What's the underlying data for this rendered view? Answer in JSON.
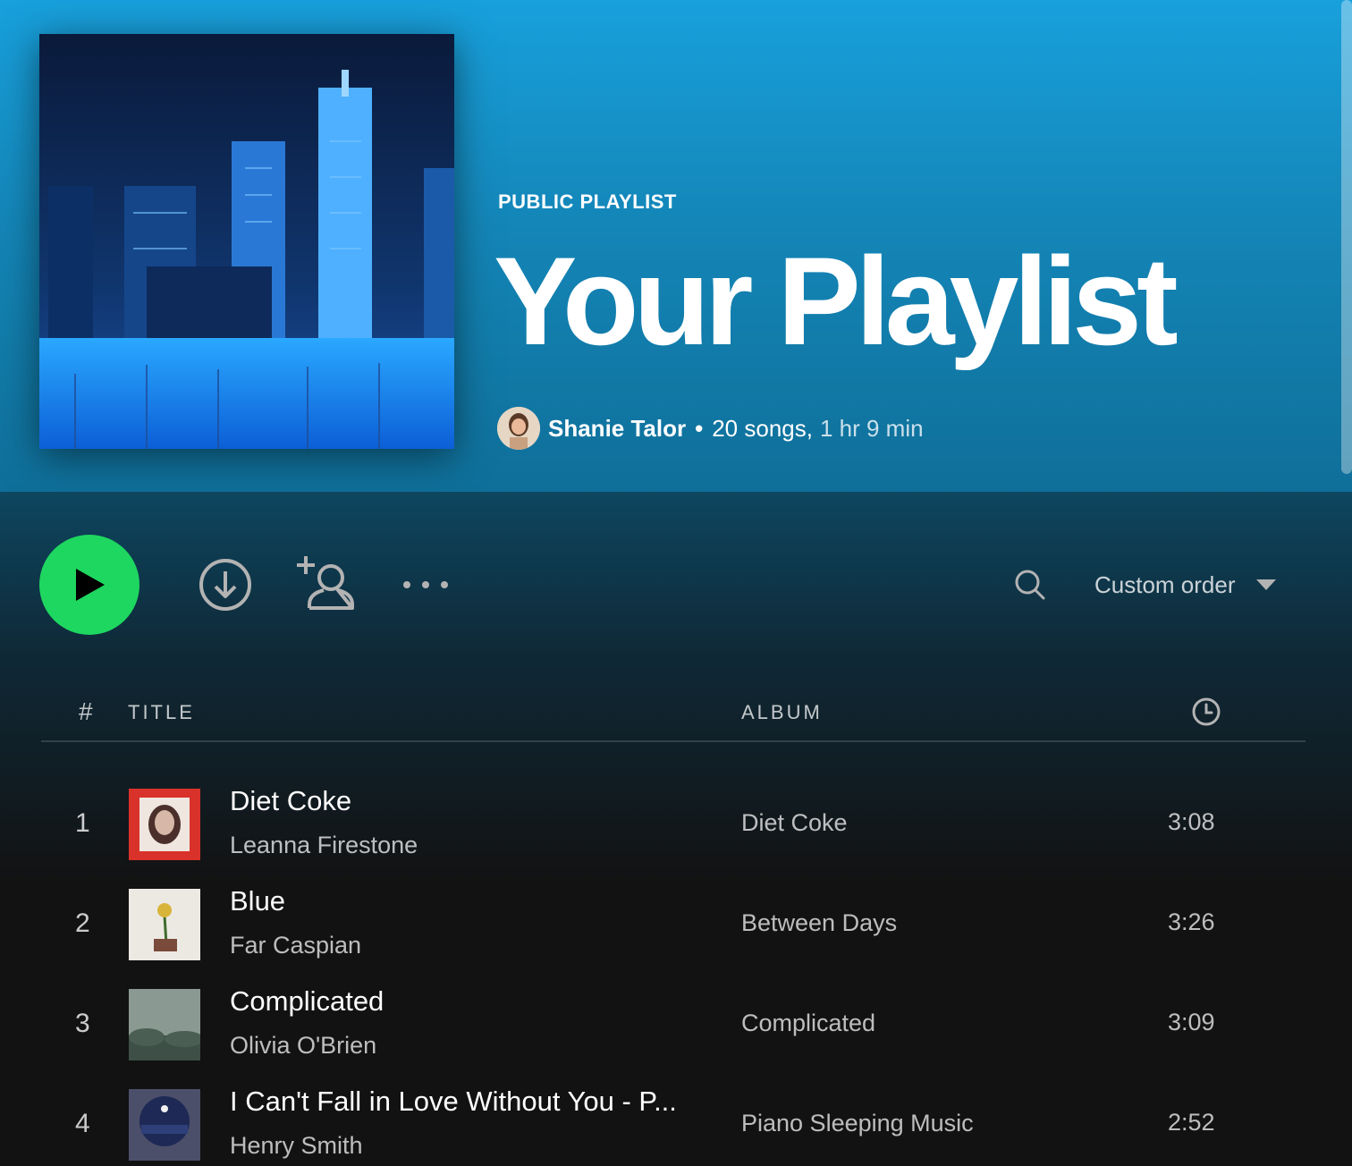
{
  "header": {
    "kind": "PUBLIC PLAYLIST",
    "title": "Your Playlist",
    "owner": "Shanie Talor",
    "separator": "•",
    "song_count": "20 songs,",
    "duration": "1 hr 9 min",
    "bg_color": "#1486b8"
  },
  "actions": {
    "play_icon": "play-icon",
    "download_icon": "download-icon",
    "follow_icon": "add-user-icon",
    "more_icon": "more-icon",
    "more_label": "• • •",
    "search_icon": "search-icon",
    "sort_label": "Custom order",
    "accent": "#1ed760"
  },
  "table": {
    "columns": {
      "number": "#",
      "title": "TITLE",
      "album": "ALBUM",
      "duration_icon": "clock-icon"
    },
    "rows": [
      {
        "number": "1",
        "title": "Diet Coke",
        "artist": "Leanna Firestone",
        "album": "Diet Coke",
        "duration": "3:08"
      },
      {
        "number": "2",
        "title": "Blue",
        "artist": "Far Caspian",
        "album": "Between Days",
        "duration": "3:26"
      },
      {
        "number": "3",
        "title": "Complicated",
        "artist": "Olivia O'Brien",
        "album": "Complicated",
        "duration": "3:09"
      },
      {
        "number": "4",
        "title": "I Can't Fall in Love Without You - P...",
        "artist": "Henry Smith",
        "album": "Piano Sleeping Music",
        "duration": "2:52"
      }
    ]
  }
}
